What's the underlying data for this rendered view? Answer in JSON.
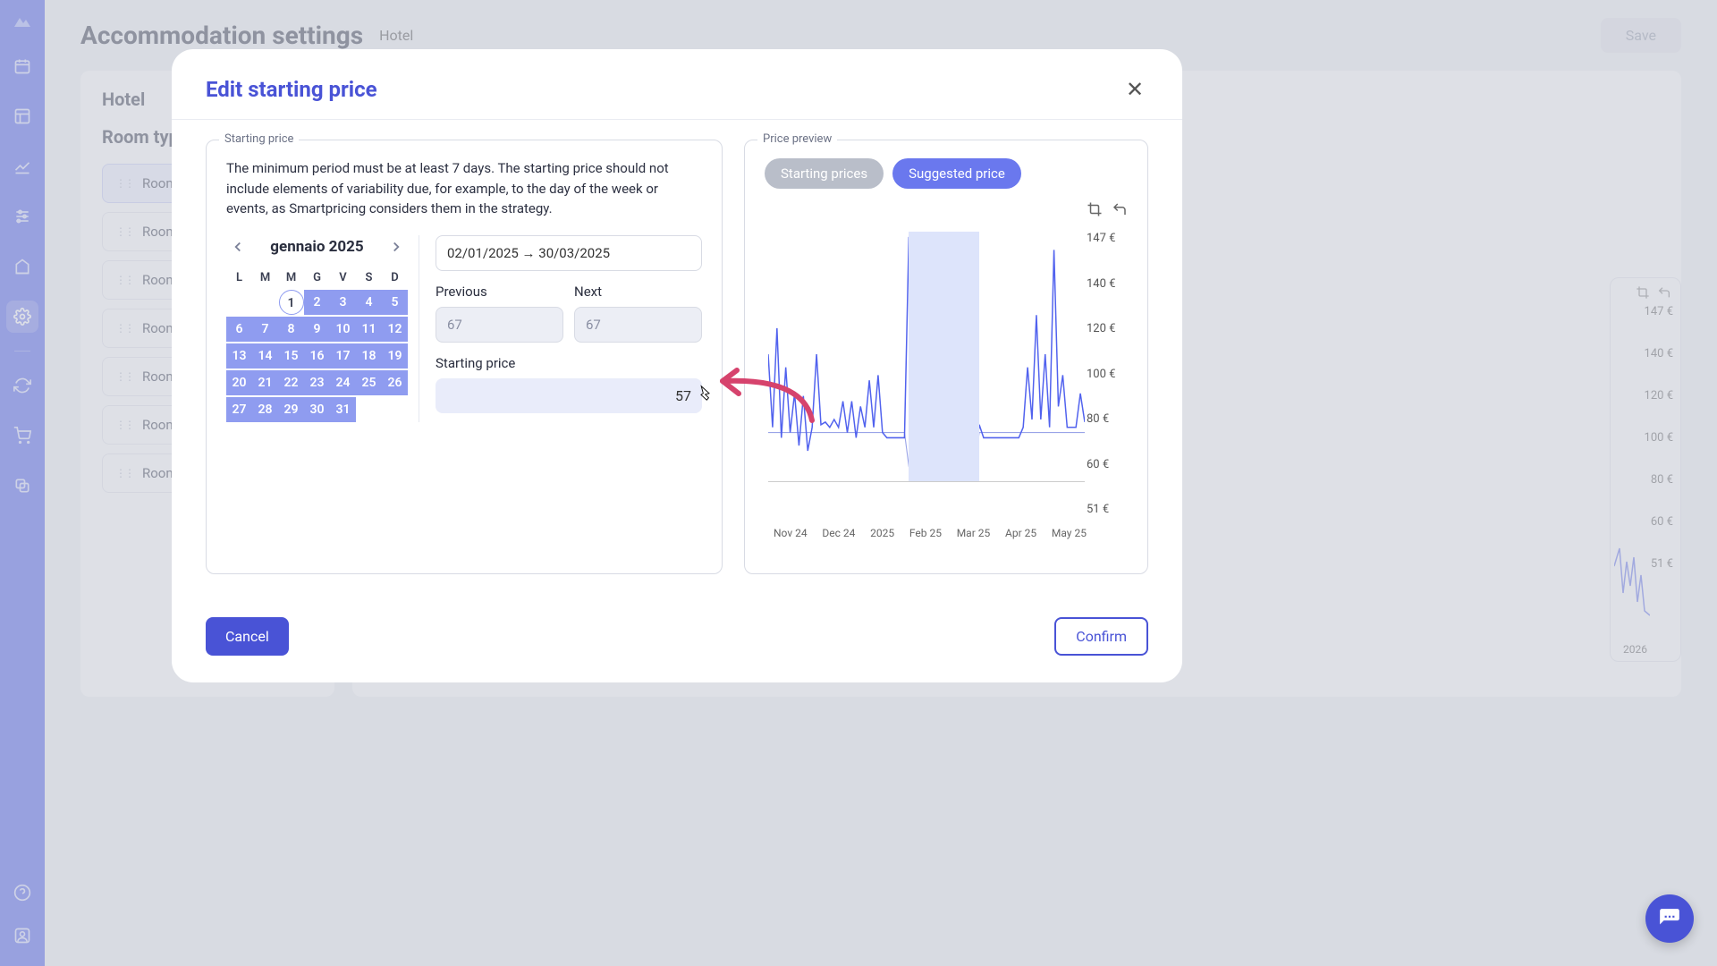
{
  "page": {
    "title": "Accommodation settings",
    "subtitle": "Hotel",
    "save": "Save"
  },
  "panel": {
    "hotel": "Hotel",
    "room_types_heading": "Room types",
    "room_items": [
      "Room type",
      "Room type",
      "Room type",
      "Room type",
      "Room type",
      "Room type",
      "Room type"
    ]
  },
  "bg_chart_labels": [
    "147 €",
    "140 €",
    "120 €",
    "100 €",
    "80 €",
    "60 €",
    "51 €"
  ],
  "bg_chart_xlabel": "2026",
  "modal": {
    "title": "Edit starting price",
    "starting_price_legend": "Starting price",
    "price_preview_legend": "Price preview",
    "description": "The minimum period must be at least 7 days. The starting price should not include elements of variability due, for example, to the day of the week or events, as Smartpricing considers them in the strategy.",
    "date_range": "02/01/2025 → 30/03/2025",
    "previous_label": "Previous",
    "next_label": "Next",
    "prev_value": "67",
    "next_value": "67",
    "sp_label": "Starting price",
    "sp_value": "57",
    "cancel": "Cancel",
    "confirm": "Confirm",
    "toggles": {
      "starting": "Starting prices",
      "suggested": "Suggested price"
    }
  },
  "calendar": {
    "month": "gennaio 2025",
    "dow": [
      "L",
      "M",
      "M",
      "G",
      "V",
      "S",
      "D"
    ],
    "days": [
      [
        "",
        "",
        "1",
        "2",
        "3",
        "4",
        "5"
      ],
      [
        "6",
        "7",
        "8",
        "9",
        "10",
        "11",
        "12"
      ],
      [
        "13",
        "14",
        "15",
        "16",
        "17",
        "18",
        "19"
      ],
      [
        "20",
        "21",
        "22",
        "23",
        "24",
        "25",
        "26"
      ],
      [
        "27",
        "28",
        "29",
        "30",
        "31",
        "",
        ""
      ]
    ],
    "start_day": "1",
    "range_from": 2,
    "range_to": 31
  },
  "chart_data": {
    "type": "line",
    "title": "Price preview",
    "ylabel": "€",
    "ylim": [
      51,
      147
    ],
    "ytick_labels": [
      "147 €",
      "140 €",
      "120 €",
      "100 €",
      "80 €",
      "60 €",
      "51 €"
    ],
    "xtick_labels": [
      "Nov 24",
      "Dec 24",
      "2025",
      "Feb 25",
      "Mar 25",
      "Apr 25",
      "May 25"
    ],
    "highlight_range": [
      "2025-02-01",
      "2025-03-30"
    ],
    "series": [
      {
        "name": "Suggested price",
        "values": [
          100,
          72,
          110,
          68,
          95,
          70,
          85,
          65,
          84,
          63,
          72,
          100,
          73,
          74,
          72,
          75,
          72,
          82,
          70,
          82,
          68,
          80,
          72,
          90,
          72,
          92,
          70,
          68,
          68,
          68,
          68,
          68,
          145,
          90,
          58,
          58,
          60,
          100,
          58,
          58,
          58,
          60,
          58,
          62,
          58,
          58,
          58,
          58,
          73,
          68,
          68,
          68,
          68,
          68,
          68,
          68,
          68,
          68,
          72,
          95,
          75,
          115,
          75,
          100,
          72,
          140,
          80,
          92,
          72,
          72,
          72,
          85,
          74
        ]
      },
      {
        "name": "Starting price (step)",
        "values": [
          70,
          70,
          70,
          70,
          70,
          70,
          70,
          70,
          70,
          70,
          70,
          70,
          70,
          70,
          70,
          70,
          70,
          70,
          70,
          70,
          70,
          70,
          70,
          70,
          70,
          70,
          70,
          70,
          70,
          70,
          70,
          70,
          57,
          57,
          57,
          57,
          57,
          57,
          57,
          57,
          57,
          57,
          57,
          57,
          57,
          57,
          57,
          57,
          70,
          70,
          70,
          70,
          70,
          70,
          70,
          70,
          70,
          70,
          70,
          70,
          70,
          70,
          70,
          70,
          70,
          70,
          70,
          70,
          70,
          70,
          70,
          70,
          70
        ]
      }
    ]
  }
}
